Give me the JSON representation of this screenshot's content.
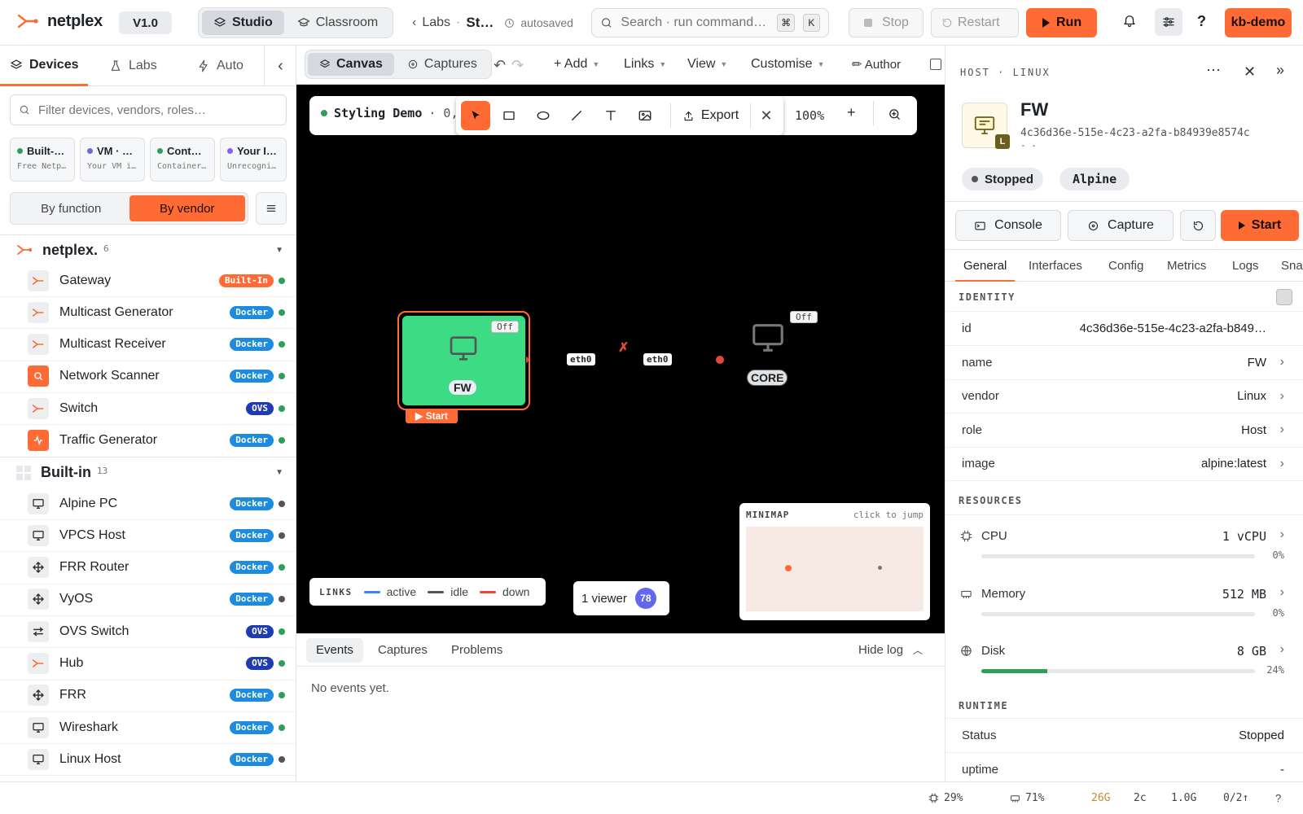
{
  "app": {
    "name": "netplex",
    "version": "V1.0"
  },
  "mode_tabs": [
    {
      "label": "Studio",
      "active": true
    },
    {
      "label": "Classroom",
      "active": false
    }
  ],
  "breadcrumb": {
    "labs": "Labs",
    "sep": "·",
    "current": "St…",
    "saved": "autosaved"
  },
  "search": {
    "placeholder": "Search · run command…",
    "k1": "⌘",
    "k2": "K"
  },
  "actions": {
    "stop": "Stop",
    "restart": "Restart",
    "run": "Run",
    "user": "kb-demo"
  },
  "left": {
    "tabs": [
      "Devices",
      "Labs",
      "Auto"
    ],
    "filter_placeholder": "Filter devices, vendors, roles…",
    "categories": [
      {
        "title": "Built-…",
        "sub": "Free Netp…",
        "color": "#2f9e58"
      },
      {
        "title": "VM · …",
        "sub": "Your VM i…",
        "color": "#6b6bd8"
      },
      {
        "title": "Cont…",
        "sub": "Container…",
        "color": "#2f9e58"
      },
      {
        "title": "Your I…",
        "sub": "Unrecogni…",
        "color": "#8b5cf6"
      }
    ],
    "group_by": {
      "function": "By function",
      "vendor": "By vendor"
    },
    "groups": [
      {
        "name": "netplex.",
        "count": "6"
      },
      {
        "name": "Built-in",
        "count": "13"
      }
    ],
    "netplex_items": [
      {
        "name": "Gateway",
        "badge": "Built-In",
        "kind": "builtin",
        "status": "on"
      },
      {
        "name": "Multicast Generator",
        "badge": "Docker",
        "kind": "docker",
        "status": "on"
      },
      {
        "name": "Multicast Receiver",
        "badge": "Docker",
        "kind": "docker",
        "status": "on"
      },
      {
        "name": "Network Scanner",
        "badge": "Docker",
        "kind": "docker",
        "status": "on"
      },
      {
        "name": "Switch",
        "badge": "OVS",
        "kind": "ovs",
        "status": "on"
      },
      {
        "name": "Traffic Generator",
        "badge": "Docker",
        "kind": "docker",
        "status": "on"
      }
    ],
    "builtin_items": [
      {
        "name": "Alpine PC",
        "badge": "Docker",
        "kind": "docker",
        "status": "off"
      },
      {
        "name": "VPCS Host",
        "badge": "Docker",
        "kind": "docker",
        "status": "off"
      },
      {
        "name": "FRR Router",
        "badge": "Docker",
        "kind": "docker",
        "status": "on"
      },
      {
        "name": "VyOS",
        "badge": "Docker",
        "kind": "docker",
        "status": "off"
      },
      {
        "name": "OVS Switch",
        "badge": "OVS",
        "kind": "ovs",
        "status": "on"
      },
      {
        "name": "Hub",
        "badge": "OVS",
        "kind": "ovs",
        "status": "on"
      },
      {
        "name": "FRR",
        "badge": "Docker",
        "kind": "docker",
        "status": "on"
      },
      {
        "name": "Wireshark",
        "badge": "Docker",
        "kind": "docker",
        "status": "on"
      },
      {
        "name": "Linux Host",
        "badge": "Docker",
        "kind": "docker",
        "status": "off"
      }
    ]
  },
  "center": {
    "view_tabs": [
      {
        "label": "Canvas",
        "active": true
      },
      {
        "label": "Captures",
        "active": false
      }
    ],
    "menus": [
      "+ Add",
      "Links",
      "View",
      "Customise"
    ],
    "author": "✏ Author",
    "lab_name": "Styling Demo",
    "lab_extra": "· 0,",
    "export": "Export",
    "zoom": "100%",
    "nodes": {
      "fw": {
        "label": "FW",
        "state": "Off",
        "start": "▶ Start"
      },
      "core": {
        "label": "CORE",
        "state": "Off"
      }
    },
    "link": {
      "a_if": "eth0",
      "b_if": "eth0",
      "mark": "✗"
    },
    "legend": {
      "title": "LINKS",
      "active": "active",
      "idle": "idle",
      "down": "down"
    },
    "viewers": {
      "label": "1 viewer",
      "count": "78"
    },
    "minimap": {
      "title": "MINIMAP",
      "hint": "click to jump"
    },
    "colors": {
      "node_on": "#3ddc84",
      "accent": "#ff6b35",
      "link_down": "#e5483a",
      "link_active": "#3b82f6"
    }
  },
  "log": {
    "tabs": [
      "Events",
      "Captures",
      "Problems"
    ],
    "hide": "Hide log",
    "empty": "No events yet."
  },
  "inspector": {
    "kicker": "HOST · LINUX",
    "title": "FW",
    "uuid": "4c36d36e-515e-4c23-a2fa-b84939e8574c",
    "uuid_tail": "- -",
    "icon_badge": "L",
    "status": "Stopped",
    "os": "Alpine",
    "buttons": {
      "console": "Console",
      "capture": "Capture",
      "start": "Start"
    },
    "tabs": [
      "General",
      "Interfaces",
      "Config",
      "Metrics",
      "Logs",
      "Snap"
    ],
    "identity_title": "IDENTITY",
    "identity": [
      {
        "k": "id",
        "v": "4c36d36e-515e-4c23-a2fa-b849…",
        "chev": false
      },
      {
        "k": "name",
        "v": "FW",
        "chev": true
      },
      {
        "k": "vendor",
        "v": "Linux",
        "chev": true
      },
      {
        "k": "role",
        "v": "Host",
        "chev": true
      },
      {
        "k": "image",
        "v": "alpine:latest",
        "chev": true
      }
    ],
    "resources_title": "RESOURCES",
    "resources": [
      {
        "k": "CPU",
        "v": "1 vCPU",
        "pct": "0%",
        "fill": 0
      },
      {
        "k": "Memory",
        "v": "512 MB",
        "pct": "0%",
        "fill": 0
      },
      {
        "k": "Disk",
        "v": "8 GB",
        "pct": "24%",
        "fill": 24
      }
    ],
    "runtime_title": "RUNTIME",
    "runtime": [
      {
        "k": "Status",
        "v": "Stopped"
      },
      {
        "k": "uptime",
        "v": "-"
      }
    ]
  },
  "statusbar": {
    "cpu": "29%",
    "mem": "71%",
    "disk": "26G",
    "cores": "2c",
    "net": "1.0G",
    "io": "0/2↑",
    "help": "?"
  }
}
